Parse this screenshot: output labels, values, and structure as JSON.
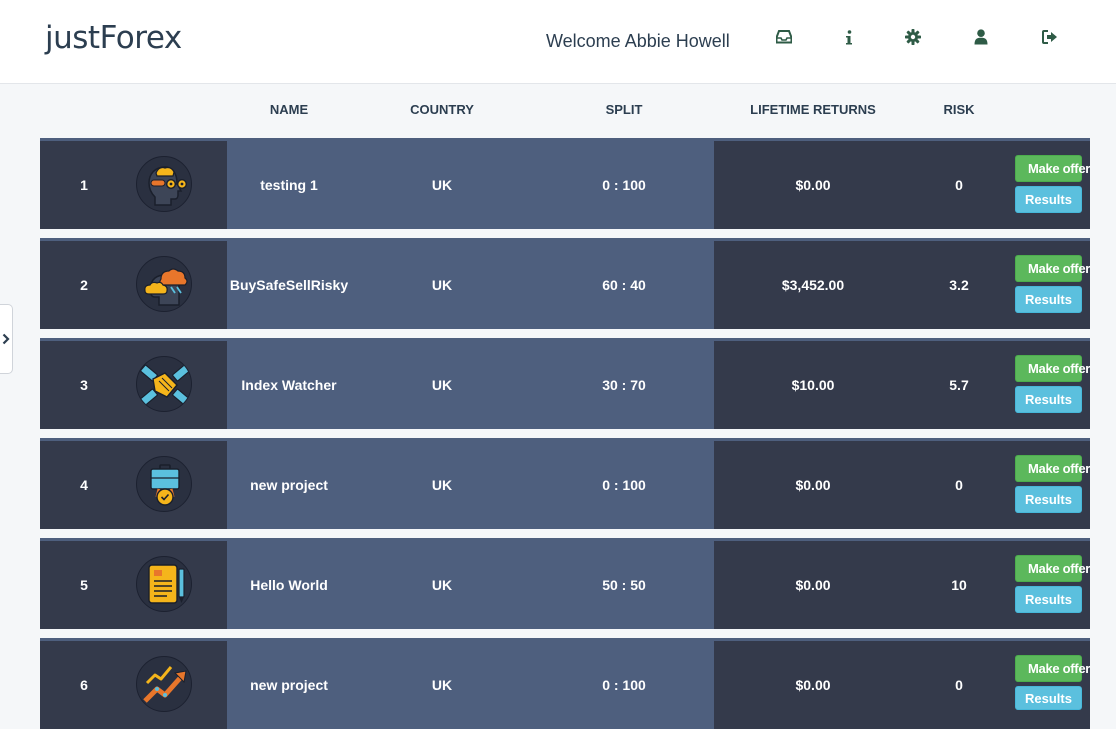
{
  "header": {
    "logo": "justForex",
    "welcome": "Welcome Abbie Howell",
    "icons": [
      "inbox-icon",
      "info-icon",
      "gear-icon",
      "user-icon",
      "logout-icon"
    ]
  },
  "table": {
    "columns": {
      "name": "NAME",
      "country": "COUNTRY",
      "split": "SPLIT",
      "returns": "LIFETIME RETURNS",
      "risk": "RISK"
    },
    "rows": [
      {
        "num": "1",
        "name": "testing 1",
        "country": "UK",
        "split": "0 : 100",
        "returns": "$0.00",
        "risk": "0",
        "avatar": "robot-head-icon"
      },
      {
        "num": "2",
        "name": "BuySafeSellRisky",
        "country": "UK",
        "split": "60 : 40",
        "returns": "$3,452.00",
        "risk": "3.2",
        "avatar": "cloud-head-icon"
      },
      {
        "num": "3",
        "name": "Index Watcher",
        "country": "UK",
        "split": "30 : 70",
        "returns": "$10.00",
        "risk": "5.7",
        "avatar": "handshake-icon"
      },
      {
        "num": "4",
        "name": "new project",
        "country": "UK",
        "split": "0 : 100",
        "returns": "$0.00",
        "risk": "0",
        "avatar": "briefcase-badge-icon"
      },
      {
        "num": "5",
        "name": "Hello World",
        "country": "UK",
        "split": "50 : 50",
        "returns": "$0.00",
        "risk": "10",
        "avatar": "document-pen-icon"
      },
      {
        "num": "6",
        "name": "new project",
        "country": "UK",
        "split": "0 : 100",
        "returns": "$0.00",
        "risk": "0",
        "avatar": "trend-arrow-icon"
      }
    ],
    "make_offer_label": "Make offer",
    "results_label": "Results"
  },
  "colors": {
    "row_dark": "#343a4b",
    "row_mid": "#4e5f7e",
    "offer_green": "#5cb85c",
    "results_blue": "#5bc0de",
    "header_icon": "#2e5b46"
  }
}
